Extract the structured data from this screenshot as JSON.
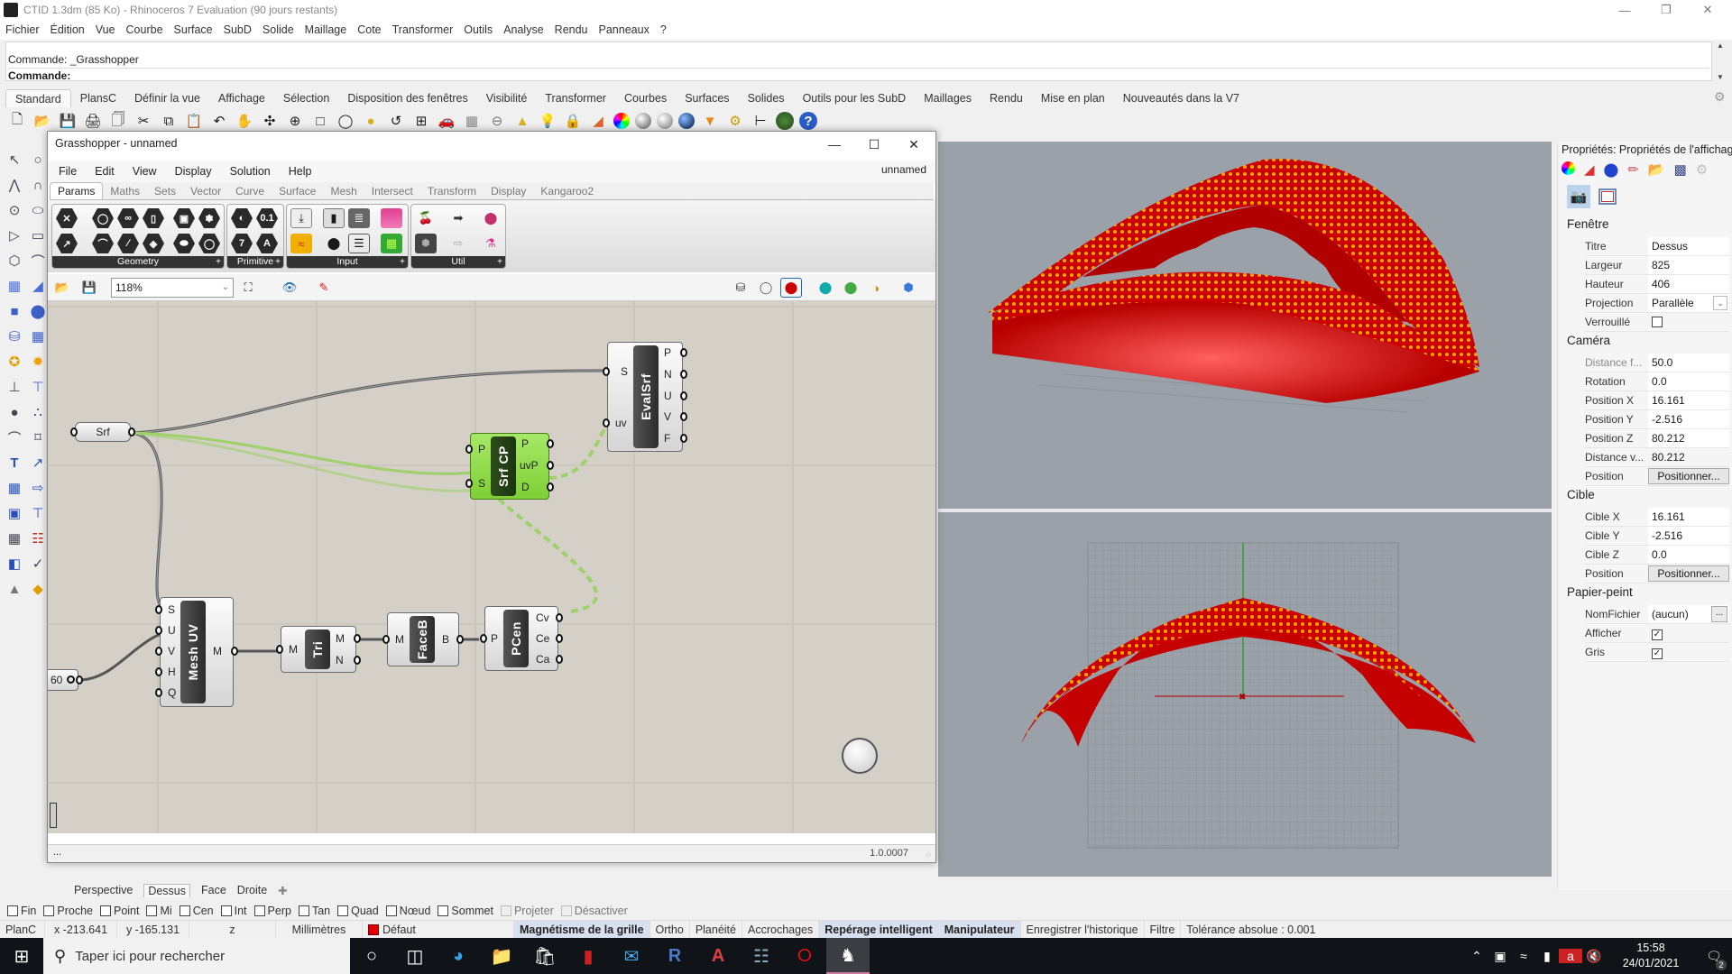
{
  "app": {
    "title": "CTID 1.3dm (85 Ko) - Rhinoceros 7 Evaluation (90 jours restants)",
    "window_controls": [
      "minimize",
      "restore",
      "close"
    ]
  },
  "menu": [
    "Fichier",
    "Édition",
    "Vue",
    "Courbe",
    "Surface",
    "SubD",
    "Solide",
    "Maillage",
    "Cote",
    "Transformer",
    "Outils",
    "Analyse",
    "Rendu",
    "Panneaux",
    "?"
  ],
  "command": {
    "history": "Commande: _Grasshopper",
    "prompt": "Commande:"
  },
  "toolbar_tabs": [
    "Standard",
    "PlansC",
    "Définir la vue",
    "Affichage",
    "Sélection",
    "Disposition des fenêtres",
    "Visibilité",
    "Transformer",
    "Courbes",
    "Surfaces",
    "Solides",
    "Outils pour les SubD",
    "Maillages",
    "Rendu",
    "Mise en plan",
    "Nouveautés dans la V7"
  ],
  "toolbar_active_tab": "Standard",
  "toolbar_icons": [
    "new-icon",
    "open-icon",
    "save-icon",
    "print-icon",
    "import-icon",
    "cut-icon",
    "copy-icon",
    "paste-icon",
    "undo-icon",
    "pan-icon",
    "rotate-view-icon",
    "zoom-in-icon",
    "zoom-window-icon",
    "zoom-extents-icon",
    "zoom-selected-icon",
    "undo-view-icon",
    "four-viewports-icon",
    "car-icon",
    "grid-options-icon",
    "cplane-icon",
    "snap-icon",
    "light-icon",
    "lock-icon",
    "layer-icon",
    "color-wheel-icon",
    "shaded-sphere-icon",
    "ghosted-sphere-icon",
    "rendered-sphere-icon",
    "render-icon",
    "options-gear-icon",
    "dimension-icon",
    "grasshopper-icon",
    "help-icon"
  ],
  "grasshopper": {
    "title": "Grasshopper - unnamed",
    "document": "unnamed",
    "menu": [
      "File",
      "Edit",
      "View",
      "Display",
      "Solution",
      "Help"
    ],
    "tabs": [
      "Params",
      "Maths",
      "Sets",
      "Vector",
      "Curve",
      "Surface",
      "Mesh",
      "Intersect",
      "Transform",
      "Display",
      "Kangaroo2"
    ],
    "active_tab": "Params",
    "ribbon_groups": [
      "Geometry",
      "Primitive",
      "Input",
      "Util"
    ],
    "zoom": "118%",
    "version": "1.0.0007",
    "status_dots": "...",
    "nodes": [
      {
        "id": "srf",
        "label": "Srf",
        "inputs": [],
        "outputs": []
      },
      {
        "id": "evalsrf",
        "label": "EvalSrf",
        "inputs": [
          "S",
          "uv"
        ],
        "outputs": [
          "P",
          "N",
          "U",
          "V",
          "F"
        ]
      },
      {
        "id": "srfcp",
        "label": "Srf CP",
        "inputs": [
          "P",
          "S"
        ],
        "outputs": [
          "P",
          "uvP",
          "D"
        ],
        "selected": true
      },
      {
        "id": "meshuv",
        "label": "Mesh UV",
        "inputs": [
          "S",
          "U",
          "V",
          "H",
          "Q"
        ],
        "outputs": [
          "M"
        ]
      },
      {
        "id": "tri",
        "label": "Tri",
        "inputs": [
          "M"
        ],
        "outputs": [
          "M",
          "N"
        ]
      },
      {
        "id": "faceb",
        "label": "FaceB",
        "inputs": [
          "M"
        ],
        "outputs": [
          "B"
        ]
      },
      {
        "id": "pcen",
        "label": "PCen",
        "inputs": [
          "P"
        ],
        "outputs": [
          "Cv",
          "Ce",
          "Ca"
        ]
      },
      {
        "id": "slider",
        "label": "60",
        "inputs": [],
        "outputs": []
      }
    ]
  },
  "viewport_tabs": [
    "Perspective",
    "Dessus",
    "Face",
    "Droite"
  ],
  "viewport_active_tab": "Dessus",
  "osnaps": [
    {
      "label": "Fin",
      "checked": false,
      "enabled": true
    },
    {
      "label": "Proche",
      "checked": false,
      "enabled": true
    },
    {
      "label": "Point",
      "checked": false,
      "enabled": true
    },
    {
      "label": "Mi",
      "checked": false,
      "enabled": true
    },
    {
      "label": "Cen",
      "checked": false,
      "enabled": true
    },
    {
      "label": "Int",
      "checked": false,
      "enabled": true
    },
    {
      "label": "Perp",
      "checked": false,
      "enabled": true
    },
    {
      "label": "Tan",
      "checked": false,
      "enabled": true
    },
    {
      "label": "Quad",
      "checked": false,
      "enabled": true
    },
    {
      "label": "Nœud",
      "checked": false,
      "enabled": true
    },
    {
      "label": "Sommet",
      "checked": false,
      "enabled": true
    },
    {
      "label": "Projeter",
      "checked": false,
      "enabled": false
    },
    {
      "label": "Désactiver",
      "checked": false,
      "enabled": false
    }
  ],
  "status": {
    "cplane": "PlanC",
    "x": "x -213.641",
    "y": "y -165.131",
    "z": "z",
    "units": "Millimètres",
    "layer": "Défaut",
    "layer_color": "#e00000",
    "grid_snap": "Magnétisme de la grille",
    "ortho": "Ortho",
    "planar": "Planéité",
    "osnap": "Accrochages",
    "smart_track": "Repérage intelligent",
    "gumball": "Manipulateur",
    "history": "Enregistrer l'historique",
    "filter": "Filtre",
    "tolerance": "Tolérance absolue : 0.001"
  },
  "properties": {
    "header": "Propriétés: Propriétés de l'affichage",
    "sections": {
      "fenetre": {
        "title": "Fenêtre",
        "titre_label": "Titre",
        "titre": "Dessus",
        "largeur_label": "Largeur",
        "largeur": "825",
        "hauteur_label": "Hauteur",
        "hauteur": "406",
        "projection_label": "Projection",
        "projection": "Parallèle",
        "verrouille_label": "Verrouillé",
        "verrouille": false
      },
      "camera": {
        "title": "Caméra",
        "distance_focale_label": "Distance f...",
        "distance_focale": "50.0",
        "rotation_label": "Rotation",
        "rotation": "0.0",
        "pos_x_label": "Position X",
        "pos_x": "16.161",
        "pos_y_label": "Position Y",
        "pos_y": "-2.516",
        "pos_z_label": "Position Z",
        "pos_z": "80.212",
        "distance_vue_label": "Distance v...",
        "distance_vue": "80.212",
        "position_label": "Position",
        "position_button": "Positionner..."
      },
      "cible": {
        "title": "Cible",
        "x_label": "Cible X",
        "x": "16.161",
        "y_label": "Cible Y",
        "y": "-2.516",
        "z_label": "Cible Z",
        "z": "0.0",
        "position_label": "Position",
        "position_button": "Positionner..."
      },
      "papier_peint": {
        "title": "Papier-peint",
        "fichier_label": "NomFichier",
        "fichier": "(aucun)",
        "browse": "...",
        "afficher_label": "Afficher",
        "afficher": true,
        "gris_label": "Gris",
        "gris": true
      }
    }
  },
  "taskbar": {
    "search_placeholder": "Taper ici pour rechercher",
    "time": "15:58",
    "date": "24/01/2021",
    "notifications": "2"
  },
  "colors": {
    "viewport_bg": "#9aa1a8",
    "model_red": "#cc0000",
    "model_yellow": "#f2a900",
    "gh_canvas": "#d4d0c8",
    "gh_selected": "#8fdc48"
  }
}
